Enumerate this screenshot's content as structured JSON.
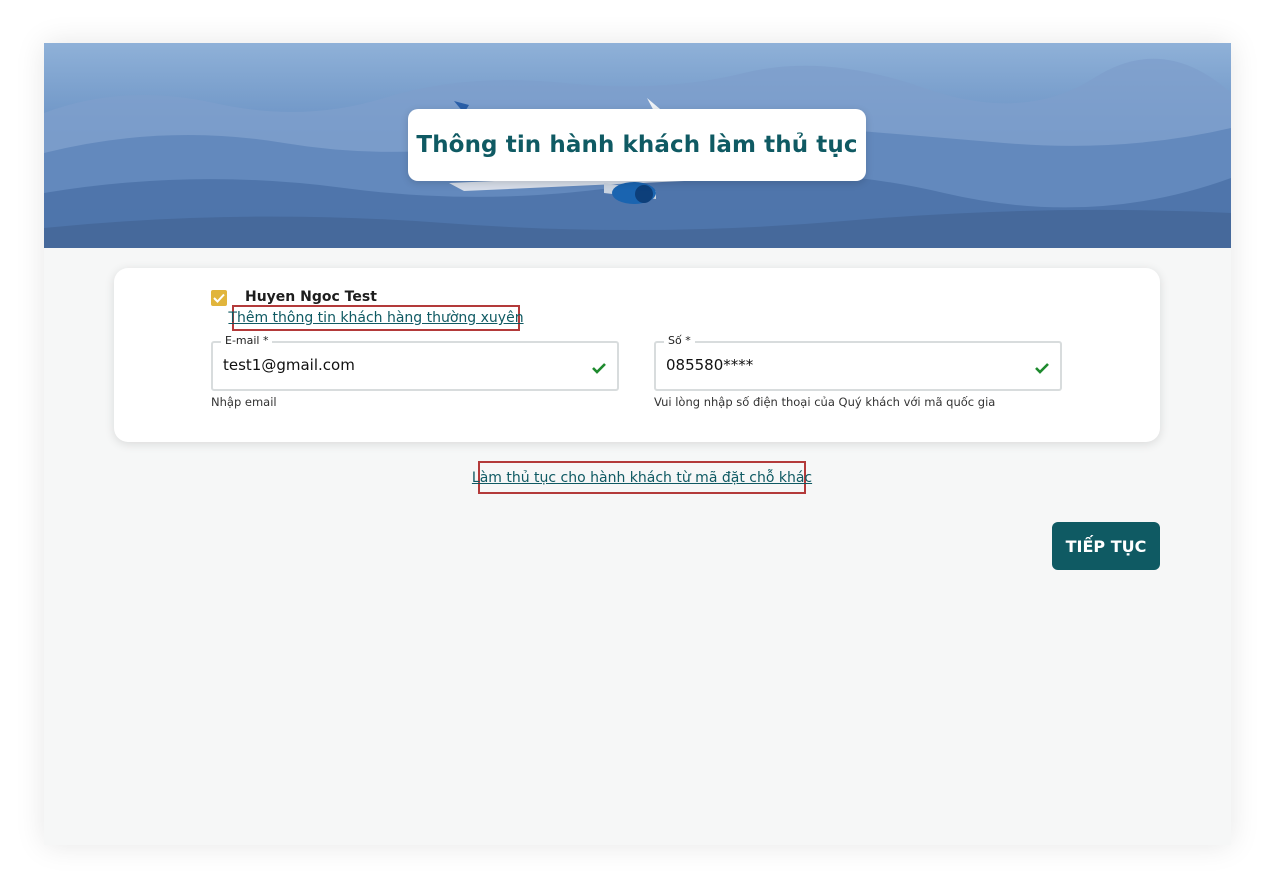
{
  "header": {
    "title": "Thông tin hành khách làm thủ tục"
  },
  "passenger": {
    "checked": true,
    "name": "Huyen Ngoc Test",
    "frequent_flyer_link": "Thêm thông tin khách hàng thường xuyên"
  },
  "form": {
    "email": {
      "label": "E-mail *",
      "value": "test1@gmail.com",
      "helper": "Nhập email",
      "valid": true
    },
    "phone": {
      "label": "Số *",
      "value": "085580****",
      "helper": "Vui lòng nhập số điện thoại của Quý khách với mã quốc gia",
      "valid": true
    }
  },
  "other_booking_link": "Làm thủ tục cho hành khách từ mã đặt chỗ khác",
  "actions": {
    "continue_label": "TIẾP TỤC"
  },
  "icons": {
    "checkbox": "checkbox-checked-icon",
    "valid": "check-icon"
  },
  "colors": {
    "brand": "#0f5a63",
    "checkbox": "#e1b53c",
    "valid": "#1e8a2e",
    "highlight": "#b33a3a"
  }
}
